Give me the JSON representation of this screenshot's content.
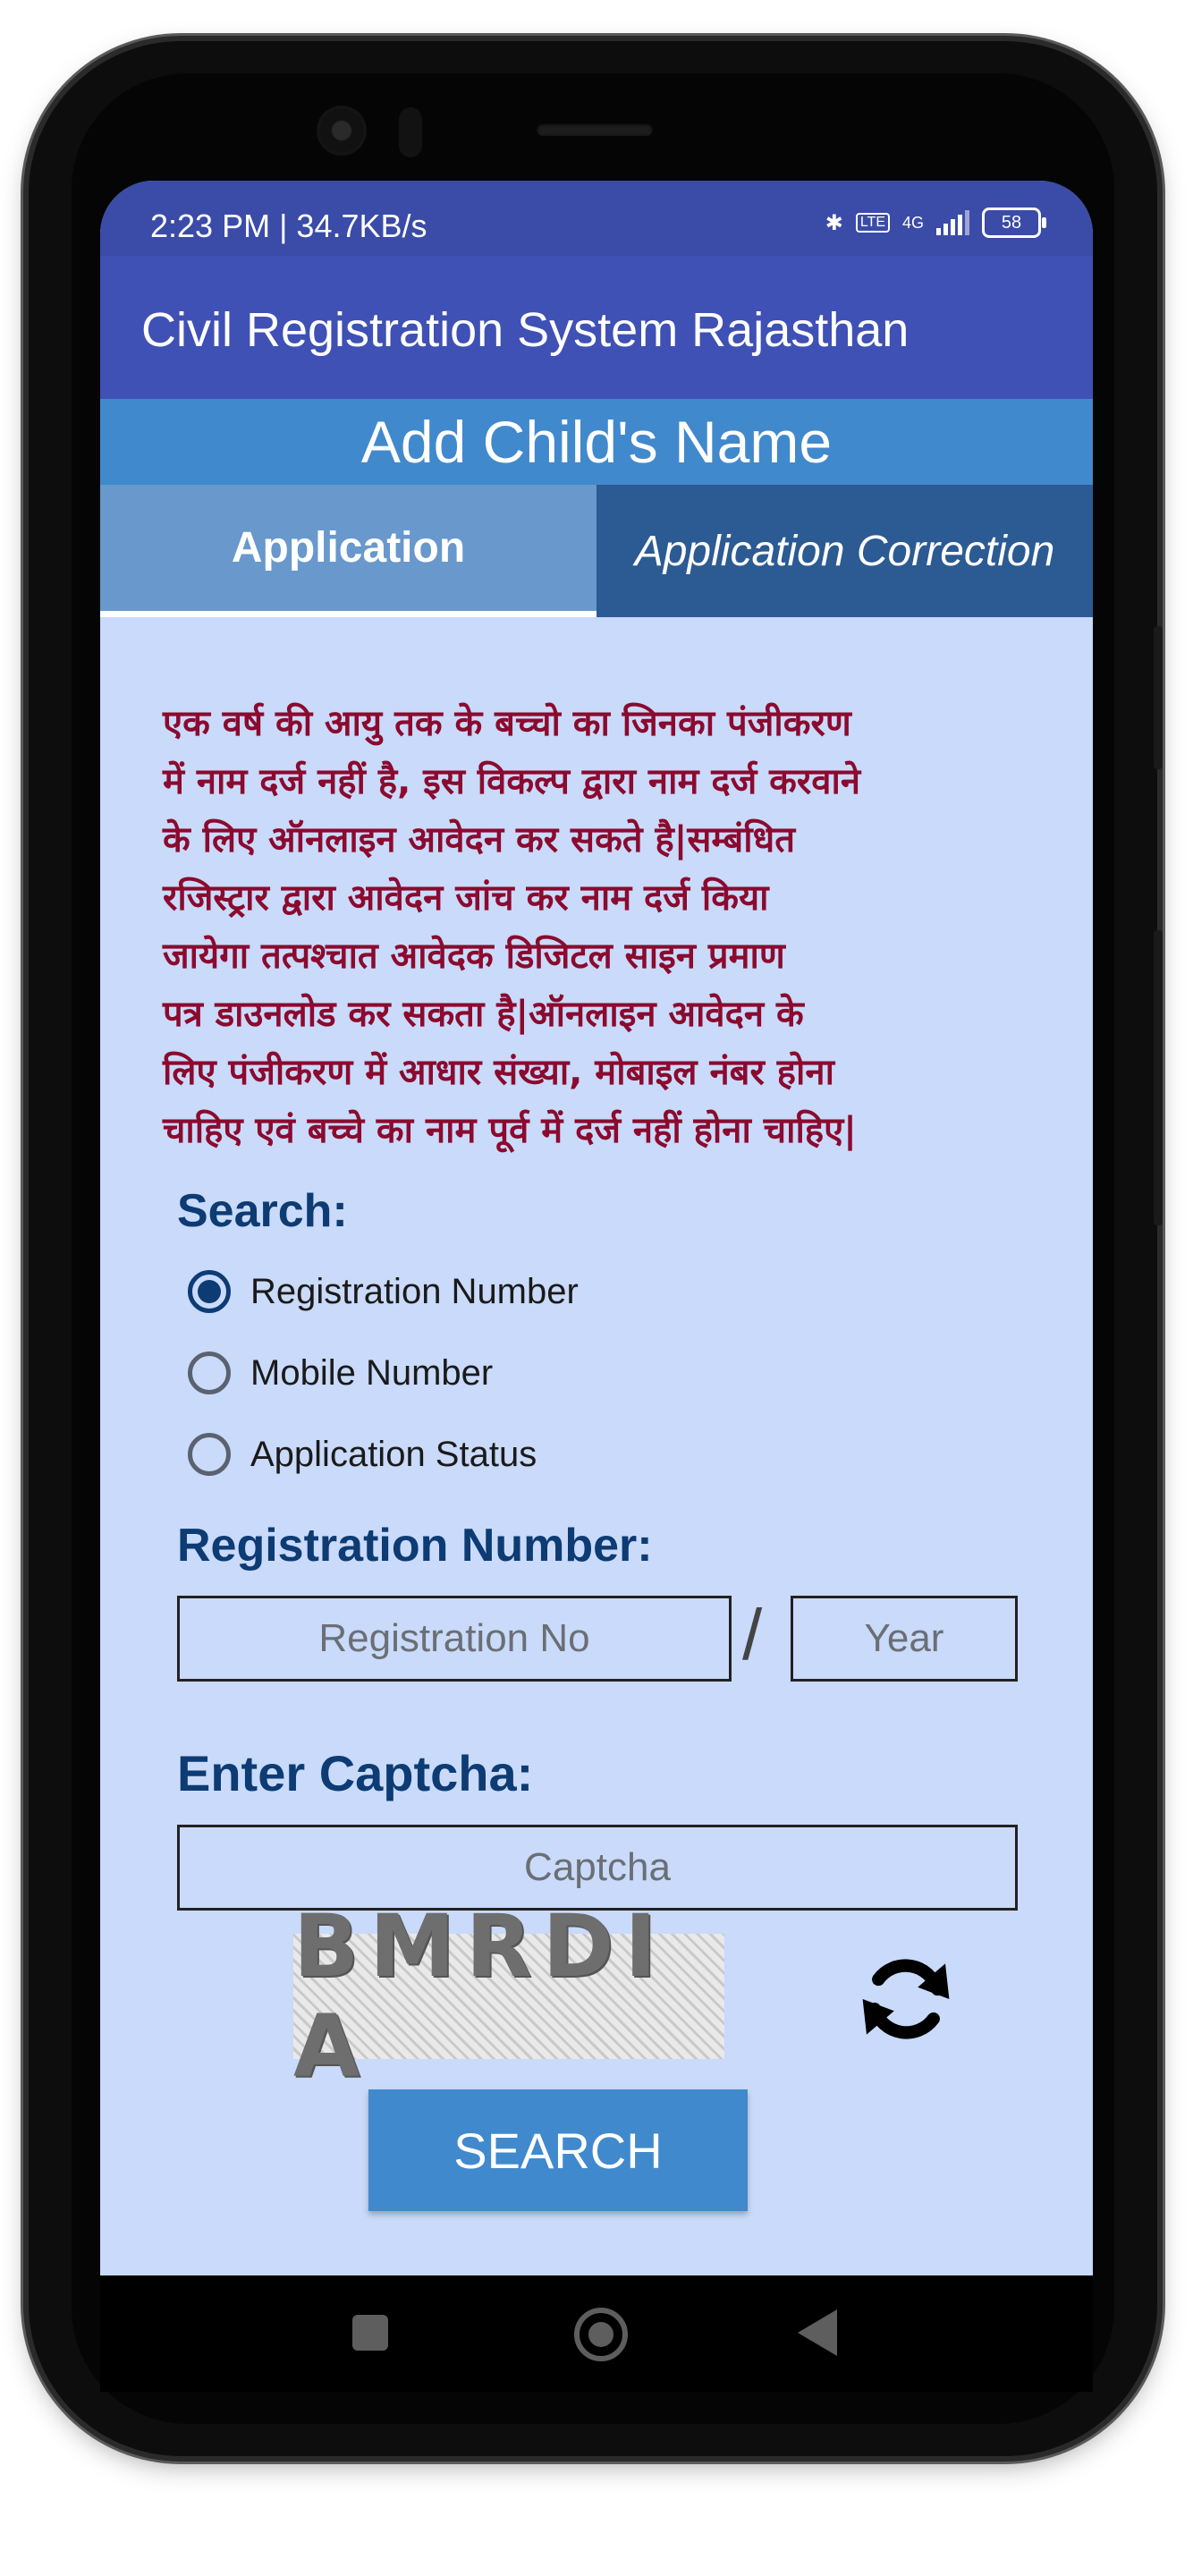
{
  "status": {
    "time": "2:23 PM | 34.7KB/s",
    "network": "4G",
    "battery": "58"
  },
  "app": {
    "title": "Civil Registration System Rajasthan"
  },
  "page": {
    "header": "Add Child's Name"
  },
  "tabs": [
    {
      "label": "Application",
      "active": true
    },
    {
      "label": "Application Correction",
      "active": false
    }
  ],
  "notice": {
    "lines": [
      "एक वर्ष की आयु तक के बच्चो का जिनका पंजीकरण",
      "में नाम दर्ज नहीं है, इस विकल्प द्वारा नाम दर्ज करवाने",
      "के लिए ऑनलाइन आवेदन कर सकते है|सम्बंधित",
      "रजिस्ट्रार द्वारा आवेदन जांच कर नाम दर्ज किया",
      "जायेगा तत्पश्चात आवेदक डिजिटल साइन प्रमाण",
      "पत्र डाउनलोड कर सकता है|ऑनलाइन आवेदन के",
      "लिए पंजीकरण में आधार संख्या, मोबाइल नंबर होना",
      "चाहिए एवं बच्चे का नाम पूर्व में दर्ज नहीं होना चाहिए|"
    ]
  },
  "search": {
    "label": "Search:",
    "options": [
      {
        "label": "Registration Number",
        "selected": true
      },
      {
        "label": "Mobile Number",
        "selected": false
      },
      {
        "label": "Application Status",
        "selected": false
      }
    ]
  },
  "registration": {
    "label": "Registration Number:",
    "number_placeholder": "Registration No",
    "separator": "/",
    "year_placeholder": "Year"
  },
  "captcha": {
    "label": "Enter Captcha:",
    "placeholder": "Captcha",
    "image_text": "BMRDI A"
  },
  "actions": {
    "search_label": "SEARCH"
  },
  "colors": {
    "appbar": "#3f51b5",
    "header": "#4189cd",
    "screen_bg": "#c9dafa",
    "notice_text": "#8b0a2e",
    "label_text": "#0d3b73"
  }
}
